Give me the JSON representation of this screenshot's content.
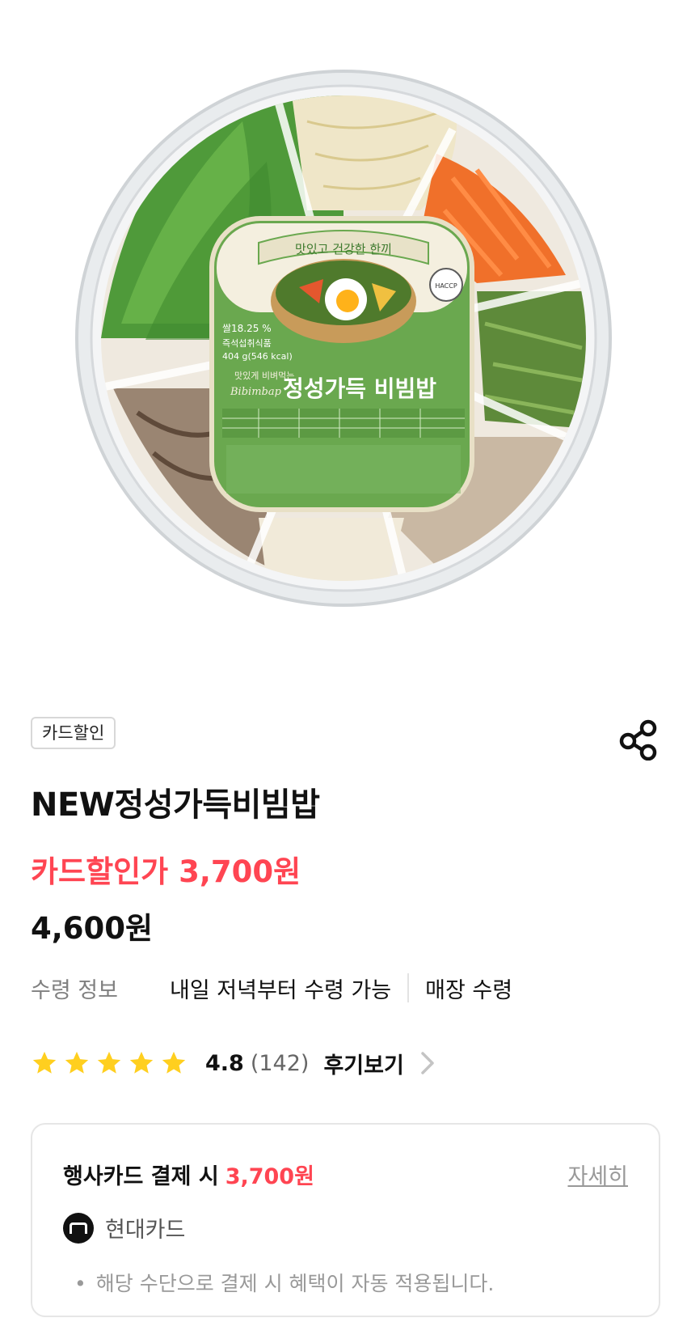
{
  "product": {
    "badge": "카드할인",
    "title": "NEW정성가득비빔밥",
    "sale_price": "카드할인가 3,700원",
    "original_price": "4,600원",
    "label_text": {
      "tagline": "맛있고 건강한 한끼",
      "small_script": "맛있게 비벼먹는",
      "romanized": "Bibimbap",
      "brand_name": "정성가득 비빔밥",
      "weight_line1": "쌀18.25 %",
      "weight_line2": "즉석섭취식품",
      "weight_line3": "404 g(546 kcal)",
      "haccp": "HACCP"
    }
  },
  "pickup": {
    "label": "수령 정보",
    "when": "내일 저녁부터 수령 가능",
    "where": "매장 수령"
  },
  "rating": {
    "stars": 5,
    "score": "4.8",
    "count": "(142)",
    "review_link": "후기보기",
    "star_color": "#ffcf1f"
  },
  "card_offer": {
    "title": "행사카드 결제 시",
    "amount": "3,700원",
    "detail_link": "자세히",
    "issuer": "현대카드",
    "note": "해당 수단으로 결제 시 혜택이 자동 적용됩니다."
  },
  "icons": {
    "share": "share-icon",
    "chevron": "chevron-right-icon",
    "card_logo": "hyundai-card-logo"
  },
  "colors": {
    "accent_red": "#ff4552",
    "label_green": "#6aa84f"
  }
}
